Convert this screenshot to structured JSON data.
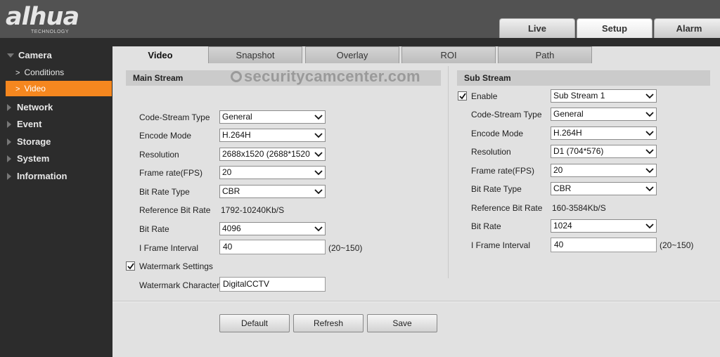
{
  "brand": {
    "logo": "alhua",
    "tagline": "TECHNOLOGY"
  },
  "top_tabs": [
    {
      "label": "Live",
      "active": false
    },
    {
      "label": "Setup",
      "active": true
    },
    {
      "label": "Alarm",
      "active": false
    }
  ],
  "sidebar": {
    "camera": "Camera",
    "conditions": "Conditions",
    "video": "Video",
    "network": "Network",
    "event": "Event",
    "storage": "Storage",
    "system": "System",
    "information": "Information",
    "active_color": "#f5871f"
  },
  "sub_tabs": [
    {
      "label": "Video",
      "active": true
    },
    {
      "label": "Snapshot",
      "active": false
    },
    {
      "label": "Overlay",
      "active": false
    },
    {
      "label": "ROI",
      "active": false
    },
    {
      "label": "Path",
      "active": false
    }
  ],
  "watermark_overlay": "securitycamcenter.com",
  "main_stream": {
    "title": "Main Stream",
    "code_stream_type": {
      "label": "Code-Stream Type",
      "value": "General"
    },
    "encode_mode": {
      "label": "Encode Mode",
      "value": "H.264H"
    },
    "resolution": {
      "label": "Resolution",
      "value": "2688x1520 (2688*1520"
    },
    "frame_rate": {
      "label": "Frame rate(FPS)",
      "value": "20"
    },
    "bit_rate_type": {
      "label": "Bit Rate Type",
      "value": "CBR"
    },
    "reference_bit_rate": {
      "label": "Reference Bit Rate",
      "value": "1792-10240Kb/S"
    },
    "bit_rate": {
      "label": "Bit Rate",
      "value": "4096"
    },
    "i_frame_interval": {
      "label": "I Frame Interval",
      "value": "40",
      "range": "(20~150)"
    },
    "watermark_settings": {
      "label": "Watermark Settings",
      "checked": true
    },
    "watermark_character": {
      "label": "Watermark Character",
      "value": "DigitalCCTV"
    }
  },
  "sub_stream": {
    "title": "Sub Stream",
    "enable": {
      "label": "Enable",
      "checked": true,
      "value": "Sub Stream 1"
    },
    "code_stream_type": {
      "label": "Code-Stream Type",
      "value": "General"
    },
    "encode_mode": {
      "label": "Encode Mode",
      "value": "H.264H"
    },
    "resolution": {
      "label": "Resolution",
      "value": "D1 (704*576)"
    },
    "frame_rate": {
      "label": "Frame rate(FPS)",
      "value": "20"
    },
    "bit_rate_type": {
      "label": "Bit Rate Type",
      "value": "CBR"
    },
    "reference_bit_rate": {
      "label": "Reference Bit Rate",
      "value": "160-3584Kb/S"
    },
    "bit_rate": {
      "label": "Bit Rate",
      "value": "1024"
    },
    "i_frame_interval": {
      "label": "I Frame Interval",
      "value": "40",
      "range": "(20~150)"
    }
  },
  "buttons": {
    "default": "Default",
    "refresh": "Refresh",
    "save": "Save"
  },
  "icons": {
    "dropdown": "chevron-down-icon",
    "checkbox": "checkmark-icon",
    "collapsed": "triangle-right-icon",
    "expanded": "triangle-down-icon"
  }
}
